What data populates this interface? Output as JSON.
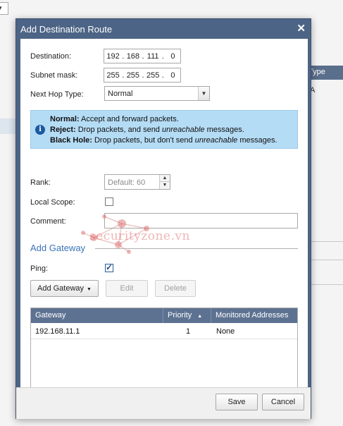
{
  "dialog": {
    "title": "Add Destination Route"
  },
  "form": {
    "destination_label": "Destination:",
    "destination_octets": [
      "192",
      "168",
      "111",
      "0"
    ],
    "subnet_label": "Subnet mask:",
    "subnet_octets": [
      "255",
      "255",
      "255",
      "0"
    ],
    "next_hop_label": "Next Hop Type:",
    "next_hop_value": "Normal",
    "rank_label": "Rank:",
    "rank_placeholder": "Default: 60",
    "local_scope_label": "Local Scope:",
    "local_scope_checked": false,
    "comment_label": "Comment:",
    "comment_value": ""
  },
  "info": {
    "normal_term": "Normal:",
    "normal_text": " Accept and forward packets.",
    "reject_term": "Reject:",
    "reject_text_a": " Drop packets, and send ",
    "reject_text_em": "unreachable",
    "reject_text_b": " messages.",
    "blackhole_term": "Black Hole:",
    "blackhole_text_a": " Drop packets, but don't send ",
    "blackhole_text_em": "unreachable",
    "blackhole_text_b": " messages."
  },
  "gateway_section": {
    "title": "Add Gateway",
    "ping_label": "Ping:",
    "ping_checked": true,
    "add_button": "Add Gateway",
    "edit_button": "Edit",
    "delete_button": "Delete",
    "columns": [
      "Gateway",
      "Priority",
      "Monitored Addresses"
    ],
    "rows": [
      {
        "gateway": "192.168.11.1",
        "priority": "1",
        "monitored": "None"
      }
    ]
  },
  "footer": {
    "save_label": "Save",
    "cancel_label": "Cancel"
  },
  "background": {
    "table_header": "Type",
    "table_cell": "A"
  },
  "watermark": {
    "text": "securityzone.vn"
  },
  "colors": {
    "dialog_frame": "#4c6485",
    "grid_header": "#5d7291",
    "section_title": "#3a73b8",
    "info_background": "#b5dcf5"
  }
}
